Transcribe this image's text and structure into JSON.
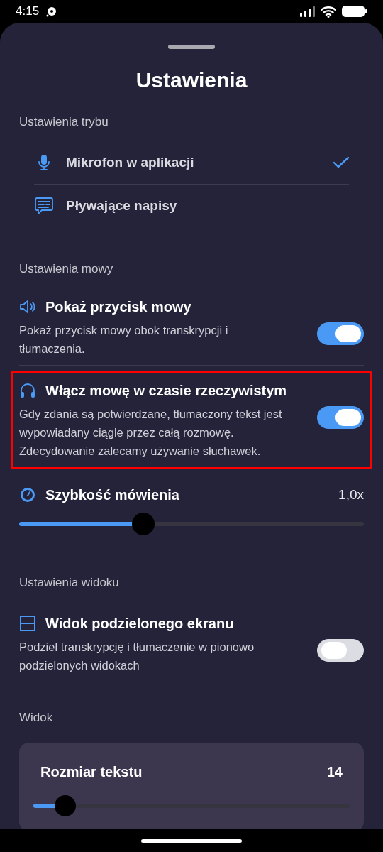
{
  "status_bar": {
    "time": "4:15"
  },
  "sheet": {
    "title": "Ustawienia"
  },
  "mode_section": {
    "label": "Ustawienia trybu",
    "items": [
      {
        "kind": "microphone",
        "label": "Mikrofon w aplikacji",
        "selected": true
      },
      {
        "kind": "captions",
        "label": "Pływające napisy",
        "selected": false
      }
    ]
  },
  "speech_section": {
    "label": "Ustawienia mowy",
    "items": [
      {
        "kind": "toggle",
        "title": "Pokaż przycisk mowy",
        "description": "Pokaż przycisk mowy obok transkrypcji i tłumaczenia.",
        "on": true,
        "highlighted": false
      },
      {
        "kind": "toggle",
        "title": "Włącz mowę w czasie rzeczywistym",
        "description": "Gdy zdania są potwierdzane, tłumaczony tekst jest wypowiadany ciągle przez całą rozmowę. Zdecydowanie zalecamy używanie słuchawek.",
        "on": true,
        "highlighted": true
      },
      {
        "kind": "slider",
        "title": "Szybkość mówienia",
        "value": "1,0x",
        "level": 0.36
      }
    ]
  },
  "view_section": {
    "label": "Ustawienia widoku",
    "items": [
      {
        "kind": "toggle",
        "title": "Widok podzielonego ekranu",
        "description": "Podziel transkrypcję i tłumaczenie w pionowo podzielonych widokach",
        "on": false,
        "highlighted": false
      }
    ]
  },
  "display_section": {
    "label": "Widok",
    "card": {
      "title": "Rozmiar tekstu",
      "value": "14",
      "level": 0.1
    }
  }
}
